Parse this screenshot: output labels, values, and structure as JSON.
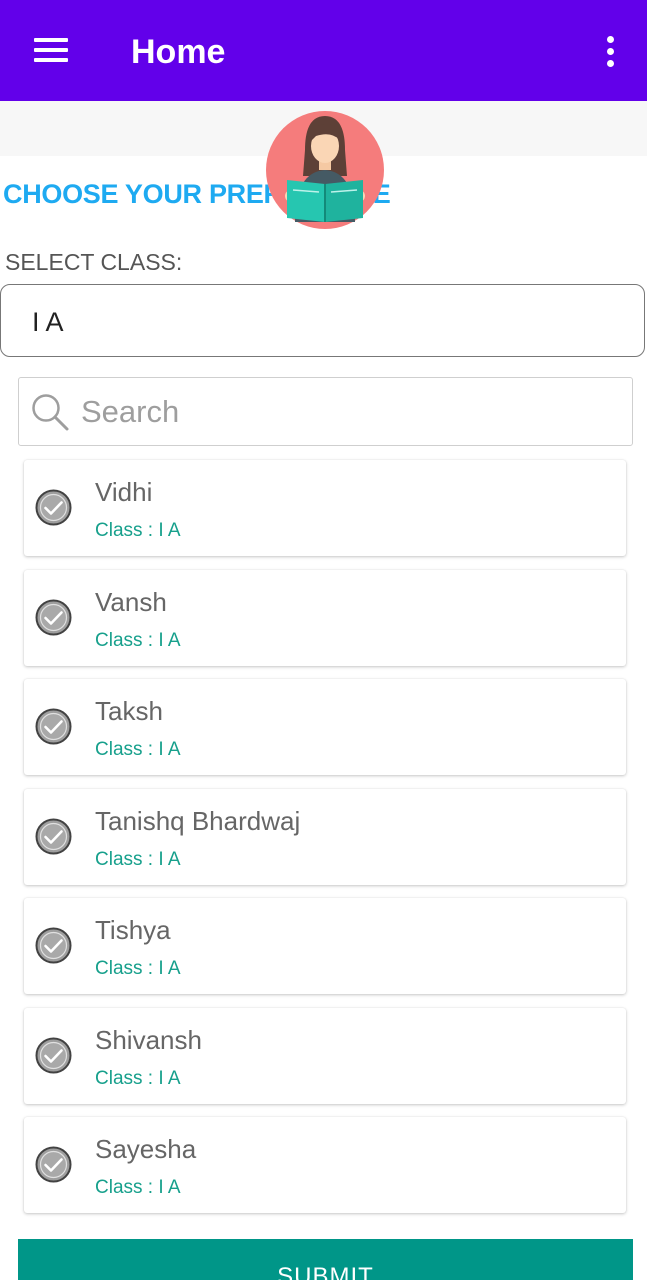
{
  "appbar": {
    "title": "Home",
    "color": "#6200ea",
    "menu_icon": "hamburger-menu-icon",
    "overflow_icon": "more-vertical-icon"
  },
  "heading": "CHOOSE YOUR PREFERENCE",
  "select_class": {
    "label": "SELECT CLASS:",
    "value": "I  A"
  },
  "search": {
    "placeholder": "Search",
    "value": "",
    "icon": "search-icon"
  },
  "students": [
    {
      "name": "Vidhi",
      "class": "Class : I  A"
    },
    {
      "name": "Vansh",
      "class": "Class : I  A"
    },
    {
      "name": "Taksh",
      "class": "Class : I  A"
    },
    {
      "name": "Tanishq Bhardwaj",
      "class": "Class : I  A"
    },
    {
      "name": "Tishya",
      "class": "Class : I  A"
    },
    {
      "name": "Shivansh",
      "class": "Class : I  A"
    },
    {
      "name": "Sayesha",
      "class": "Class : I  A"
    }
  ],
  "submit_label": "SUBMIT",
  "colors": {
    "accent": "#1eaaf1",
    "class_text": "#17a08c",
    "submit": "#009688"
  }
}
